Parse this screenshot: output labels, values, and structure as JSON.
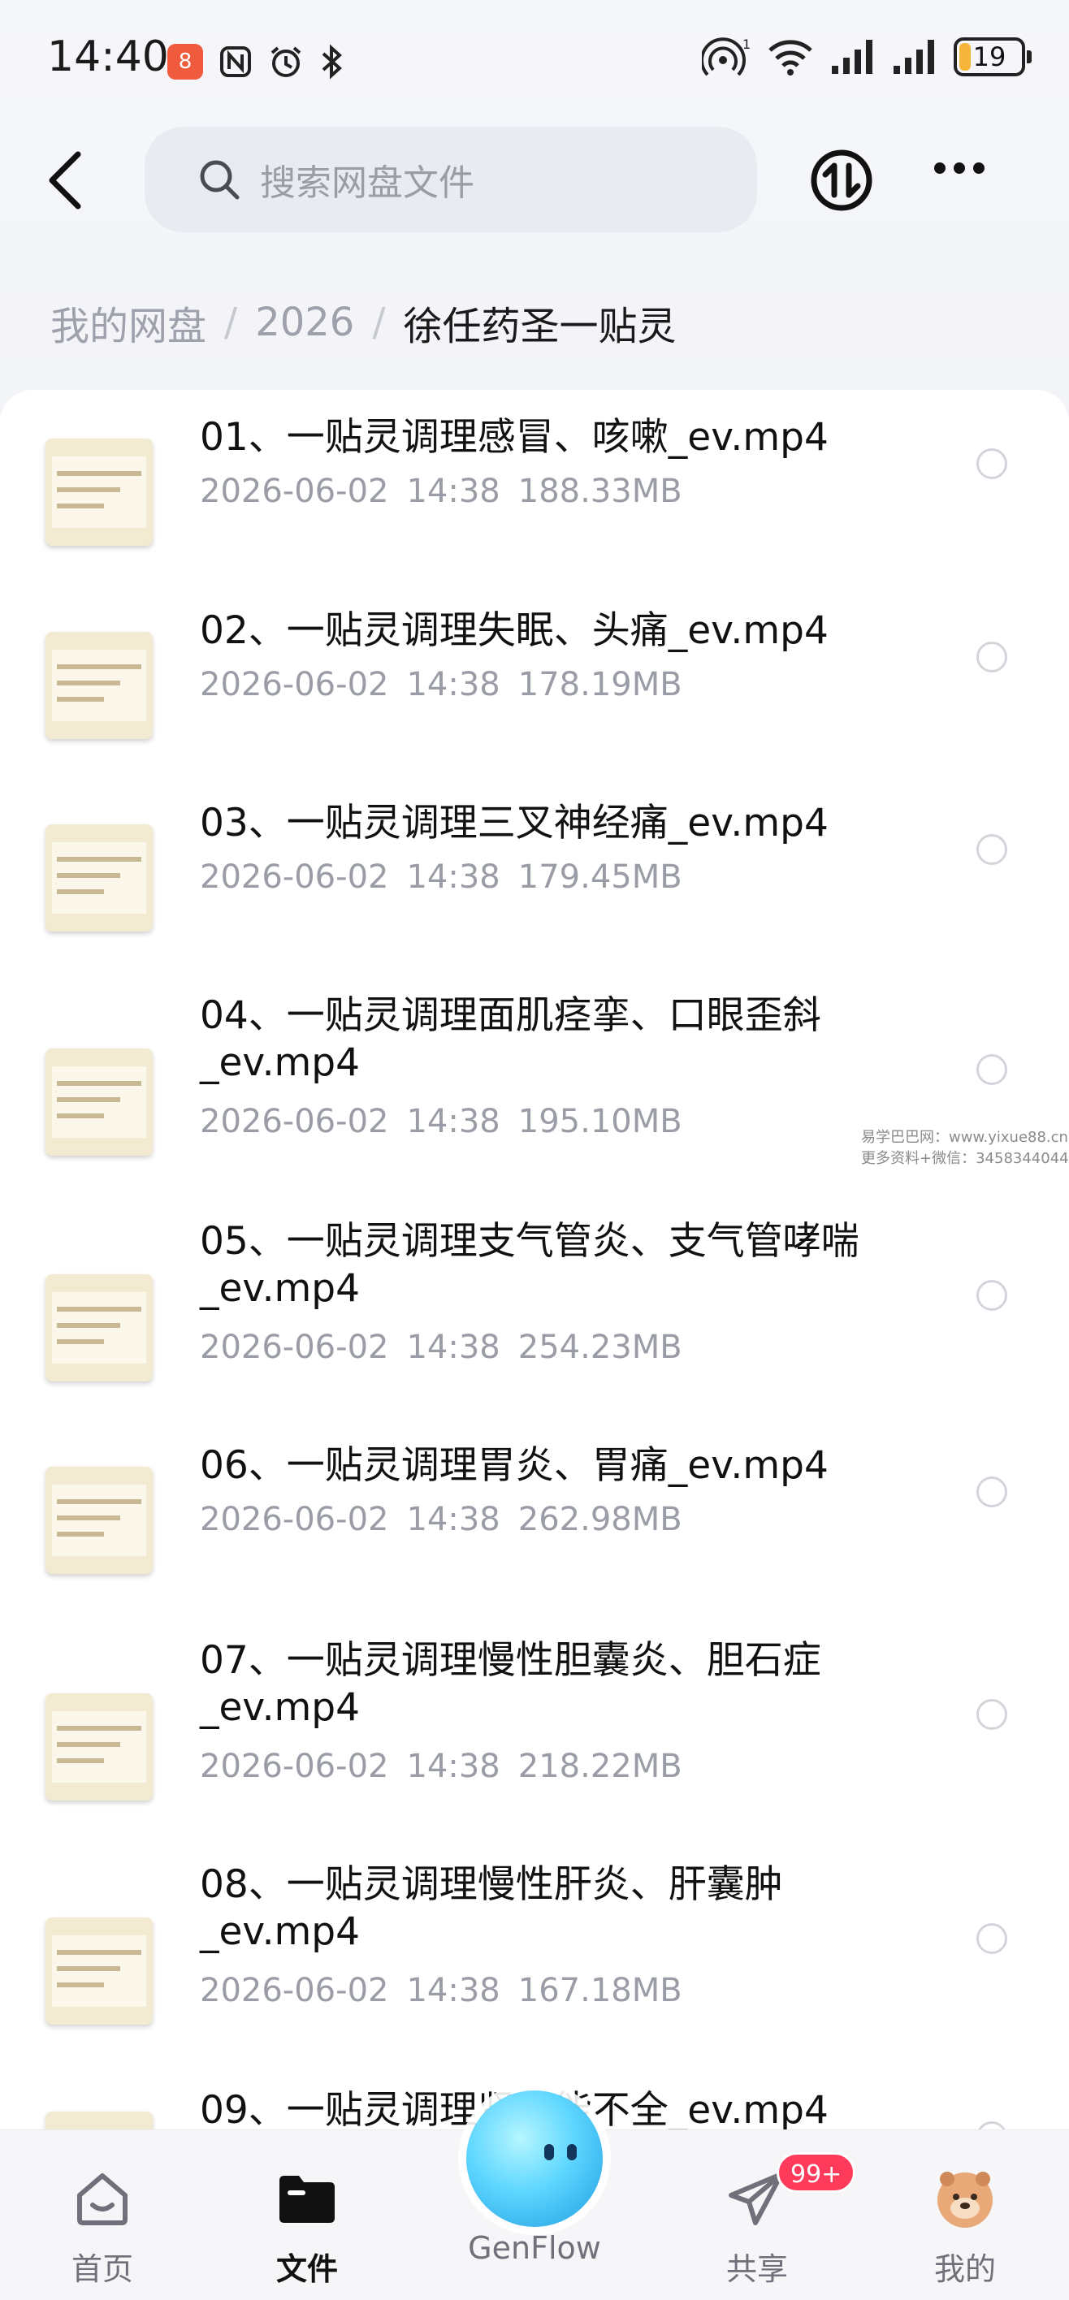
{
  "status_bar": {
    "time": "14:40",
    "notification_badge": "8",
    "battery": "19",
    "battery_level_percent": 19,
    "wifi_sub": "1",
    "icons": [
      "n-icon",
      "alarm-icon",
      "bluetooth-icon",
      "hotspot-icon",
      "wifi-icon",
      "signal-icon",
      "signal-icon",
      "battery-icon"
    ]
  },
  "header": {
    "search_placeholder": "搜索网盘文件"
  },
  "breadcrumb": {
    "items": [
      "我的网盘",
      "2026"
    ],
    "separator": "/",
    "current": "徐任药圣一贴灵"
  },
  "files": [
    {
      "title": "01、一贴灵调理感冒、咳嗽_ev.mp4",
      "date": "2026-06-02",
      "time": "14:38",
      "size": "188.33MB"
    },
    {
      "title": "02、一贴灵调理失眠、头痛_ev.mp4",
      "date": "2026-06-02",
      "time": "14:38",
      "size": "178.19MB"
    },
    {
      "title": "03、一贴灵调理三叉神经痛_ev.mp4",
      "date": "2026-06-02",
      "time": "14:38",
      "size": "179.45MB"
    },
    {
      "title": "04、一贴灵调理面肌痉挛、口眼歪斜_ev.mp4",
      "date": "2026-06-02",
      "time": "14:38",
      "size": "195.10MB"
    },
    {
      "title": "05、一贴灵调理支气管炎、支气管哮喘_ev.mp4",
      "date": "2026-06-02",
      "time": "14:38",
      "size": "254.23MB"
    },
    {
      "title": "06、一贴灵调理胃炎、胃痛_ev.mp4",
      "date": "2026-06-02",
      "time": "14:38",
      "size": "262.98MB"
    },
    {
      "title": "07、一贴灵调理慢性胆囊炎、胆石症_ev.mp4",
      "date": "2026-06-02",
      "time": "14:38",
      "size": "218.22MB"
    },
    {
      "title": "08、一贴灵调理慢性肝炎、肝囊肿_ev.mp4",
      "date": "2026-06-02",
      "time": "14:38",
      "size": "167.18MB"
    },
    {
      "title": "09、一贴灵调理肾功能不全_ev.mp4",
      "date": "",
      "time": "",
      "size": ""
    }
  ],
  "bottom_nav": {
    "home": "首页",
    "files": "文件",
    "genflow": "GenFlow",
    "share": "共享",
    "share_badge": "99+",
    "me": "我的"
  },
  "watermark": {
    "line1": "易学巴巴网：www.yixue88.cn",
    "line2": "更多资料+微信：3458344044"
  },
  "colors": {
    "accent_battery": "#f5b53b",
    "badge_red": "#ff3b5c",
    "notification_red": "#ef5b3c",
    "genflow_blue": "#5dd6ff"
  }
}
